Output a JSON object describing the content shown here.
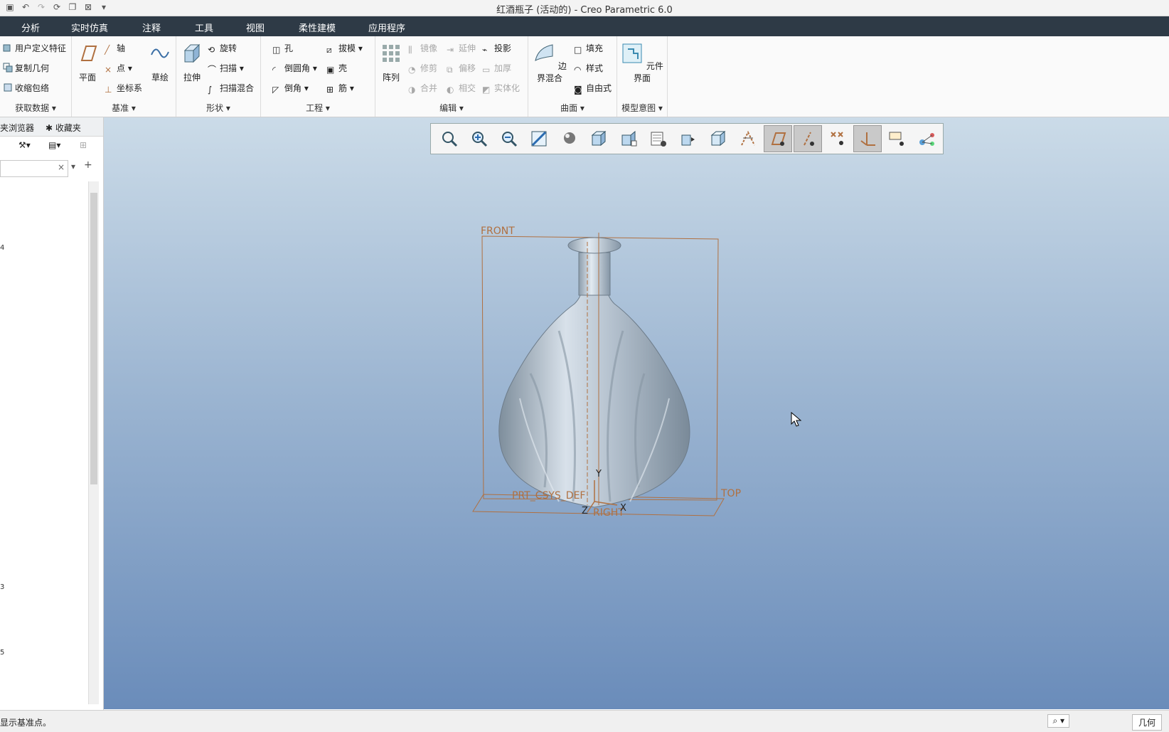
{
  "window": {
    "title": "红酒瓶子 (活动的) - Creo Parametric 6.0"
  },
  "menu": {
    "tabs": [
      "分析",
      "实时仿真",
      "注释",
      "工具",
      "视图",
      "柔性建模",
      "应用程序"
    ]
  },
  "ribbon": {
    "get_data": {
      "items": [
        "用户定义特征",
        "复制几何",
        "收缩包络"
      ],
      "label": "获取数据"
    },
    "datum": {
      "plane": "平面",
      "axis": "轴",
      "point": "点",
      "csys": "坐标系",
      "sketch": "草绘",
      "label": "基准"
    },
    "shapes": {
      "extrude": "拉伸",
      "revolve": "旋转",
      "sweep": "扫描",
      "swept_blend": "扫描混合",
      "label": "形状"
    },
    "engineering": {
      "hole": "孔",
      "draft": "拔模",
      "round": "倒圆角",
      "shell": "壳",
      "chamfer": "倒角",
      "rib": "筋",
      "label": "工程"
    },
    "editing": {
      "pattern": "阵列",
      "mirror": "镜像",
      "extend": "延伸",
      "project": "投影",
      "trim": "修剪",
      "offset": "偏移",
      "thicken": "加厚",
      "merge": "合并",
      "intersect": "相交",
      "solidify": "实体化",
      "label": "编辑"
    },
    "surfaces": {
      "boundary_blend": "边界混合",
      "fill": "填充",
      "style": "样式",
      "freestyle": "自由式",
      "label": "曲面"
    },
    "model_intent": {
      "component_interface": "元件界面",
      "label": "模型意图"
    }
  },
  "sidebar": {
    "tab_browser": "夹浏览器",
    "tab_favorites": "收藏夹",
    "markers": [
      "4",
      "3",
      "5"
    ]
  },
  "viewport": {
    "plane_labels": {
      "front": "FRONT",
      "top": "TOP",
      "right": "RIGHT",
      "csys": "PRT_CSYS_DEF"
    },
    "axes": {
      "y": "Y",
      "x": "X",
      "z": "Z"
    }
  },
  "status": {
    "message": "显示基准点。",
    "filter": "几何"
  },
  "colors": {
    "menubar": "#2e3a46",
    "datum": "#b07040",
    "bg_top": "#cbdbe8",
    "bg_bottom": "#6a8cba"
  }
}
